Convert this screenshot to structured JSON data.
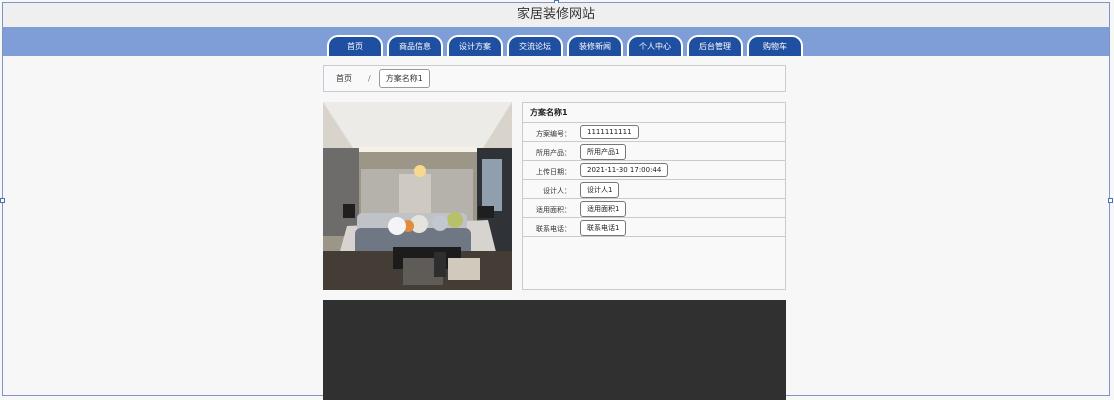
{
  "site": {
    "title": "家居装修网站"
  },
  "nav": {
    "tabs": [
      {
        "label": "首页"
      },
      {
        "label": "商品信息"
      },
      {
        "label": "设计方案"
      },
      {
        "label": "交流论坛"
      },
      {
        "label": "装修新闻"
      },
      {
        "label": "个人中心"
      },
      {
        "label": "后台管理"
      },
      {
        "label": "购物车"
      }
    ]
  },
  "breadcrumb": {
    "home": "首页",
    "separator": "/",
    "current": "方案名称1"
  },
  "detail": {
    "title": "方案名称1",
    "fields": [
      {
        "label": "方案编号：",
        "value": "1111111111"
      },
      {
        "label": "所用产品：",
        "value": "所用产品1"
      },
      {
        "label": "上传日期：",
        "value": "2021-11-30 17:00:44"
      },
      {
        "label": "设计人：",
        "value": "设计人1"
      },
      {
        "label": "适用面积：",
        "value": "适用面积1"
      },
      {
        "label": "联系电话：",
        "value": "联系电话1"
      }
    ]
  },
  "colors": {
    "nav_bar": "#7f9ed8",
    "nav_tab": "#1f4fa0",
    "dark_panel": "#303030"
  }
}
